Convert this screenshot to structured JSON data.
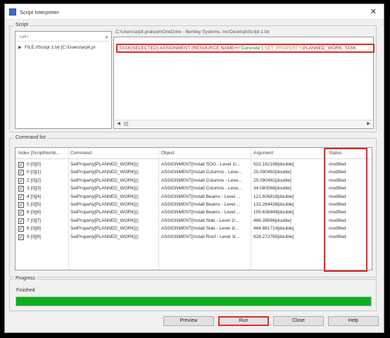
{
  "window": {
    "title": "Script Interpreter"
  },
  "script_group": {
    "label": "Script",
    "filter_placeholder": "<all>",
    "tree_item": "FILE://Script 1.txt [C:\\Users\\arpit.pr",
    "path": "C:\\Users\\arpit.prakash\\OneDrive - Bentley Systems, Inc\\Desktop\\Script 1.txt",
    "code": {
      "part1": "TASK(SELECTED).ASSIGNMENT (RESOURCE.NAME==",
      "part2": "\"Concrete\"",
      "part3": ")",
      "part4": " SET_PROPERTY(",
      "part5": "PLANNED_WORK, TASK"
    }
  },
  "command_group": {
    "label": "Command list",
    "columns": [
      "Index [ScriptNumb...",
      "Command",
      "Object",
      "Argument",
      "Status"
    ],
    "rows": [
      {
        "checked": true,
        "index": "0 [0][0]",
        "command": "SetProperty[PLANNED_WORK]()",
        "object": "ASSIGNMENT[Install SOG - Level 1/...",
        "argument": "522.162188[double]",
        "status": "modified"
      },
      {
        "checked": true,
        "index": "0 [0][1]",
        "command": "SetProperty[PLANNED_WORK]()",
        "object": "ASSIGNMENT[Install Columns - Leve...",
        "argument": "25.090492[double]",
        "status": "modified"
      },
      {
        "checked": true,
        "index": "2 [0][2]",
        "command": "SetProperty[PLANNED_WORK]()",
        "object": "ASSIGNMENT[Install Columns - Leve...",
        "argument": "25.090492[double]",
        "status": "modified"
      },
      {
        "checked": true,
        "index": "3 [0][3]",
        "command": "SetProperty[PLANNED_WORK]()",
        "object": "ASSIGNMENT[Install Columns - Leve...",
        "argument": "34.080568[double]",
        "status": "modified"
      },
      {
        "checked": true,
        "index": "4 [0][4]",
        "command": "SetProperty[PLANNED_WORK]()",
        "object": "ASSIGNMENT[Install Beams - Level ...",
        "argument": "121.606818[double]",
        "status": "modified"
      },
      {
        "checked": true,
        "index": "5 [0][5]",
        "command": "SetProperty[PLANNED_WORK]()",
        "object": "ASSIGNMENT[Install Beams - Level ...",
        "argument": "131.264438[double]",
        "status": "modified"
      },
      {
        "checked": true,
        "index": "6 [0][6]",
        "command": "SetProperty[PLANNED_WORK]()",
        "object": "ASSIGNMENT[Install Beams - Level ...",
        "argument": "105.636849[double]",
        "status": "modified"
      },
      {
        "checked": true,
        "index": "7 [0][7]",
        "command": "SetProperty[PLANNED_WORK]()",
        "object": "ASSIGNMENT[Install Slab - Level 2/...",
        "argument": "466.39566[double]",
        "status": "modified"
      },
      {
        "checked": true,
        "index": "8 [0][8]",
        "command": "SetProperty[PLANNED_WORK]()",
        "object": "ASSIGNMENT[Install Slab - Level 3/...",
        "argument": "464.881714[double]",
        "status": "modified"
      },
      {
        "checked": true,
        "index": "9 [0][9]",
        "command": "SetProperty[PLANNED_WORK]()",
        "object": "ASSIGNMENT[Install Roof - Level 3/...",
        "argument": "828.272765[double]",
        "status": "modified"
      }
    ]
  },
  "progress_group": {
    "label": "Progress",
    "status": "Finished",
    "value_percent": 100,
    "color": "#0bb11d"
  },
  "buttons": {
    "preview": "Preview",
    "run": "Run",
    "close": "Close",
    "help": "Help"
  }
}
